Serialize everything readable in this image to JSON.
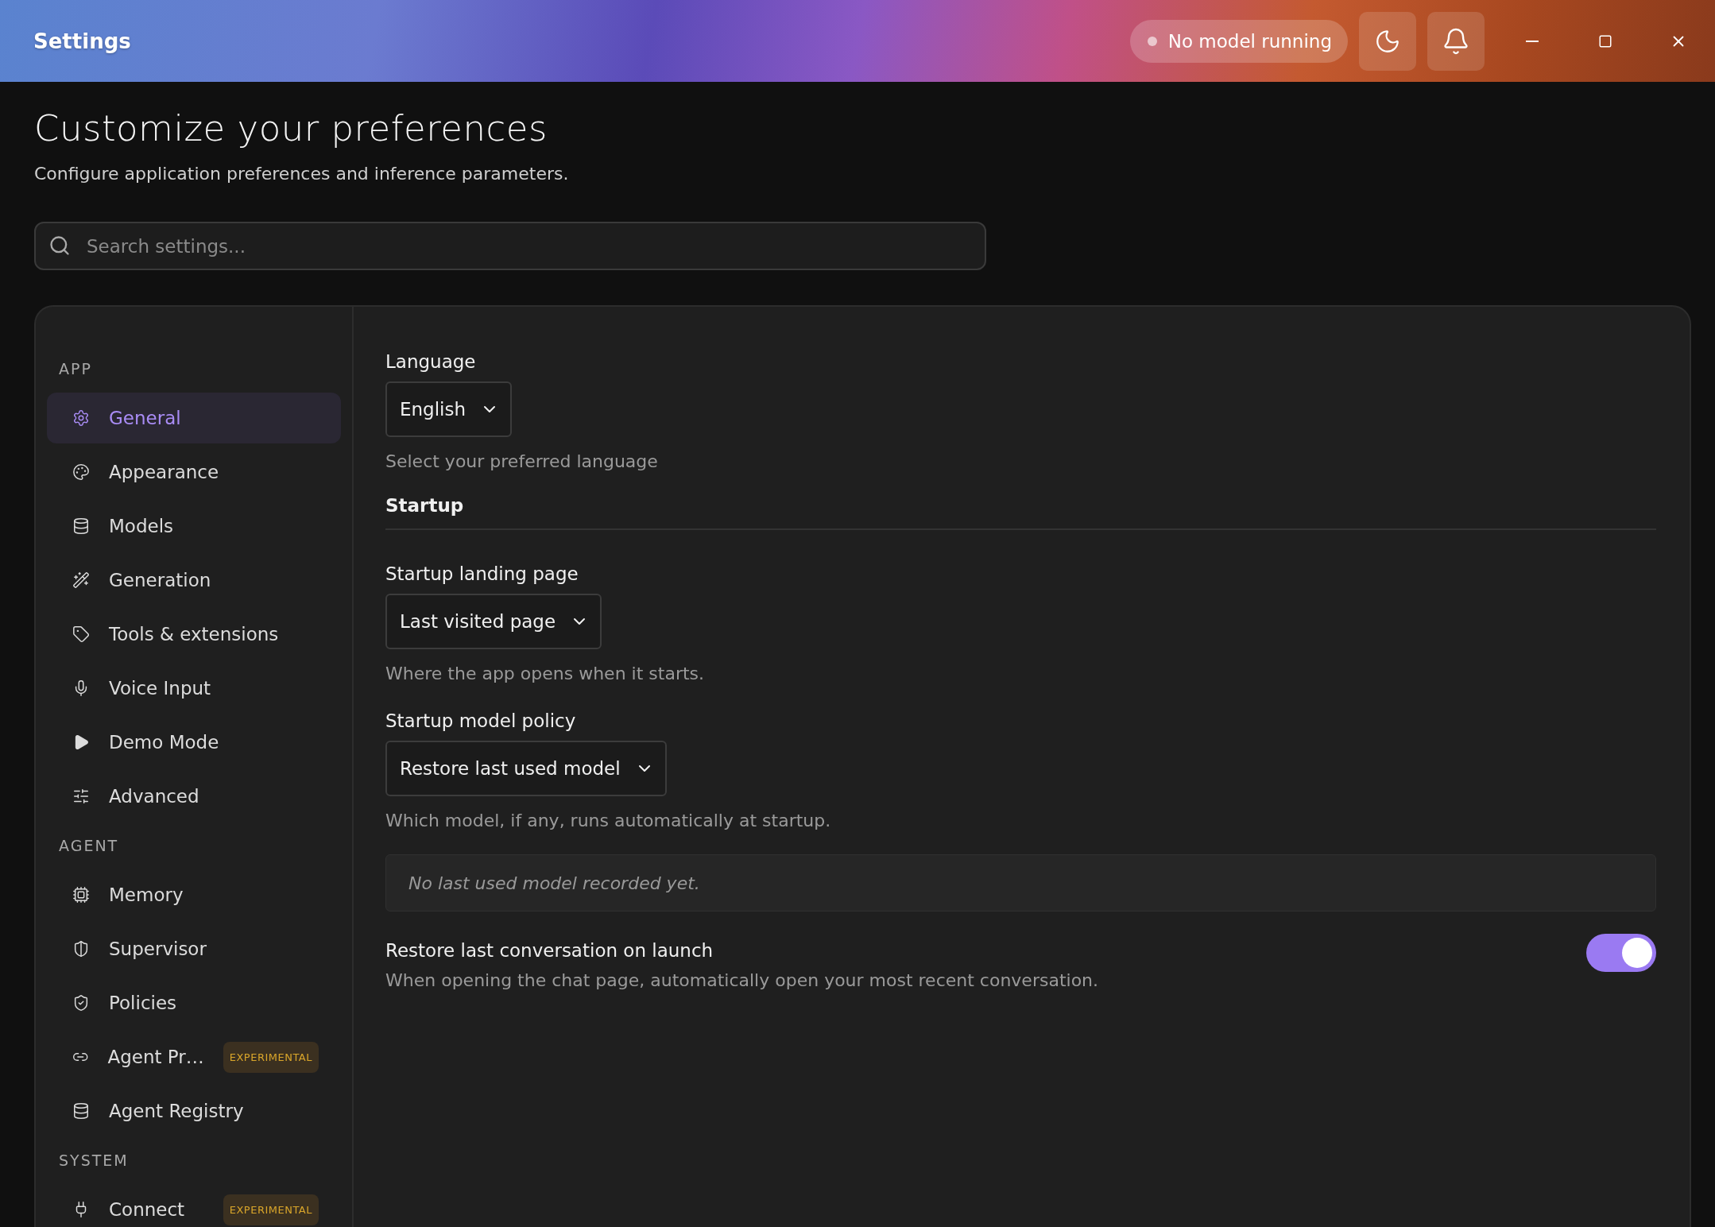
{
  "window": {
    "title": "Settings"
  },
  "status": {
    "label": "No model running",
    "running": false
  },
  "page": {
    "title": "Customize your preferences",
    "subtitle": "Configure application preferences and inference parameters."
  },
  "search": {
    "placeholder": "Search settings..."
  },
  "sidebar": {
    "sections": [
      {
        "heading": "APP",
        "items": [
          {
            "label": "General",
            "selected": true
          },
          {
            "label": "Appearance",
            "selected": false
          },
          {
            "label": "Models",
            "selected": false
          },
          {
            "label": "Generation",
            "selected": false
          },
          {
            "label": "Tools & extensions",
            "selected": false
          },
          {
            "label": "Voice Input",
            "selected": false
          },
          {
            "label": "Demo Mode",
            "selected": false
          },
          {
            "label": "Advanced",
            "selected": false
          }
        ]
      },
      {
        "heading": "AGENT",
        "items": [
          {
            "label": "Memory",
            "selected": false
          },
          {
            "label": "Supervisor",
            "selected": false
          },
          {
            "label": "Policies",
            "selected": false
          },
          {
            "label": "Agent Pr…",
            "selected": false,
            "badge": "EXPERIMENTAL"
          },
          {
            "label": "Agent Registry",
            "selected": false
          }
        ]
      },
      {
        "heading": "SYSTEM",
        "items": [
          {
            "label": "Connect",
            "selected": false,
            "badge": "EXPERIMENTAL"
          }
        ]
      }
    ]
  },
  "content": [
    {
      "kind": "select",
      "label": "Language",
      "value": "English",
      "help": "Select your preferred language"
    },
    {
      "kind": "heading",
      "label": "Startup"
    },
    {
      "kind": "select",
      "label": "Startup landing page",
      "value": "Last visited page",
      "help": "Where the app opens when it starts."
    },
    {
      "kind": "select",
      "label": "Startup model policy",
      "value": "Restore last used model",
      "help": "Which model, if any, runs automatically at startup."
    },
    {
      "kind": "info",
      "text": "No last used model recorded yet."
    },
    {
      "kind": "toggle",
      "label": "Restore last conversation on launch",
      "help": "When opening the chat page, automatically open your most recent conversation.",
      "on": true
    }
  ]
}
